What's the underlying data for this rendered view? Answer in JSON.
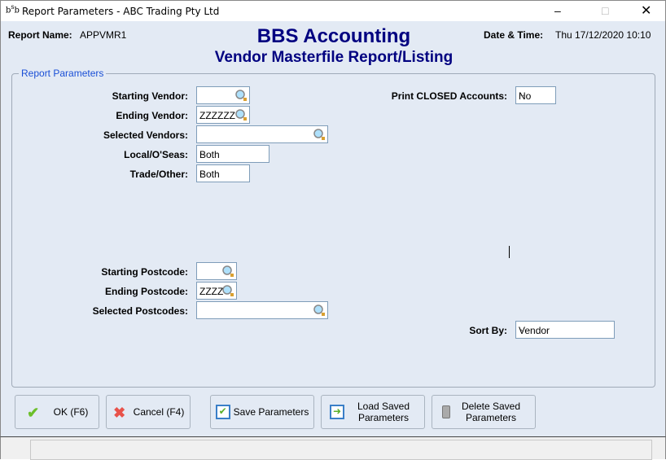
{
  "window": {
    "title": "Report Parameters - ABC Trading Pty Ltd",
    "logo": "bsb"
  },
  "header": {
    "report_name_label": "Report Name:",
    "report_name": "APPVMR1",
    "app_title": "BBS Accounting",
    "report_title": "Vendor Masterfile Report/Listing",
    "datetime_label": "Date & Time:",
    "datetime": "Thu 17/12/2020 10:10"
  },
  "group": {
    "title": "Report Parameters"
  },
  "fields": {
    "starting_vendor": {
      "label": "Starting Vendor:",
      "value": ""
    },
    "ending_vendor": {
      "label": "Ending Vendor:",
      "value": "ZZZZZZ"
    },
    "selected_vendors": {
      "label": "Selected Vendors:",
      "value": ""
    },
    "local_oseas": {
      "label": "Local/O'Seas:",
      "value": "Both"
    },
    "trade_other": {
      "label": "Trade/Other:",
      "value": "Both"
    },
    "print_closed": {
      "label": "Print CLOSED Accounts:",
      "value": "No"
    },
    "starting_postcode": {
      "label": "Starting Postcode:",
      "value": ""
    },
    "ending_postcode": {
      "label": "Ending Postcode:",
      "value": "ZZZZ"
    },
    "selected_postcodes": {
      "label": "Selected Postcodes:",
      "value": ""
    },
    "sort_by": {
      "label": "Sort By:",
      "value": "Vendor"
    }
  },
  "buttons": {
    "ok": "OK (F6)",
    "cancel": "Cancel (F4)",
    "save": "Save Parameters",
    "load1": "Load Saved",
    "load2": "Parameters",
    "delete1": "Delete Saved",
    "delete2": "Parameters"
  },
  "colors": {
    "title": "#000080",
    "group_title": "#1a4fd6",
    "background": "#e3eaf4"
  }
}
